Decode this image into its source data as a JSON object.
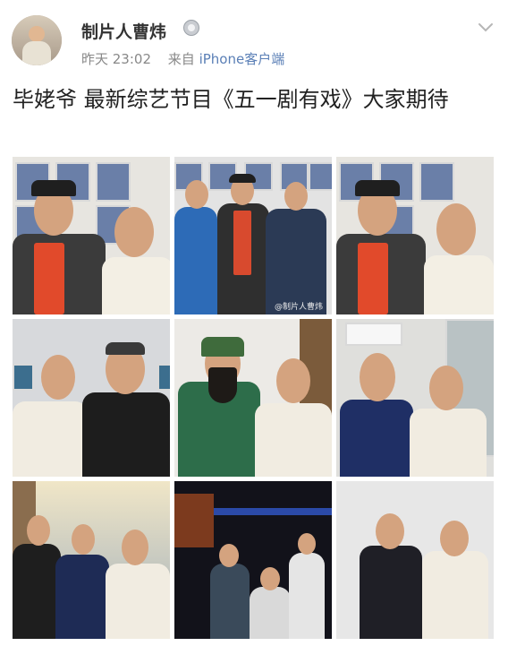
{
  "header": {
    "username": "制片人曹炜",
    "time": "昨天 23:02",
    "source_prefix": "来自",
    "source": "iPhone客户端",
    "badge_icon": "medal-icon",
    "menu_icon": "chevron-down-icon"
  },
  "post": {
    "text": "毕姥爷 最新综艺节目《五一剧有戏》大家期待"
  },
  "photos": [
    {
      "name": "photo-1"
    },
    {
      "name": "photo-2",
      "watermark": "@制片人曹炜"
    },
    {
      "name": "photo-3"
    },
    {
      "name": "photo-4"
    },
    {
      "name": "photo-5"
    },
    {
      "name": "photo-6"
    },
    {
      "name": "photo-7"
    },
    {
      "name": "photo-8"
    },
    {
      "name": "photo-9"
    }
  ]
}
